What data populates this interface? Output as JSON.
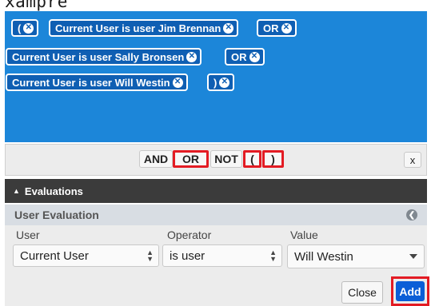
{
  "top_text": "xampre",
  "expression": {
    "row1": {
      "open_paren": "(",
      "condition": "Current User is user Jim Brennan",
      "operator": "OR"
    },
    "row2": {
      "condition": "Current User is user Sally Bronsen",
      "operator": "OR"
    },
    "row3": {
      "condition": "Current User is user Will Westin",
      "close_paren": ")"
    }
  },
  "toolbar": {
    "and": "AND",
    "or": "OR",
    "not": "NOT",
    "open": "(",
    "close": ")",
    "x": "x"
  },
  "evaluations": {
    "header": "Evaluations",
    "title": "User Evaluation"
  },
  "form": {
    "user_label": "User",
    "user_value": "Current User",
    "operator_label": "Operator",
    "operator_value": "is user",
    "value_label": "Value",
    "value_value": "Will Westin"
  },
  "buttons": {
    "close": "Close",
    "add": "Add"
  },
  "colors": {
    "pill": "#0f5fb3",
    "panel": "#1c86d9",
    "highlight": "#e31b23",
    "add": "#0b5ed7"
  }
}
